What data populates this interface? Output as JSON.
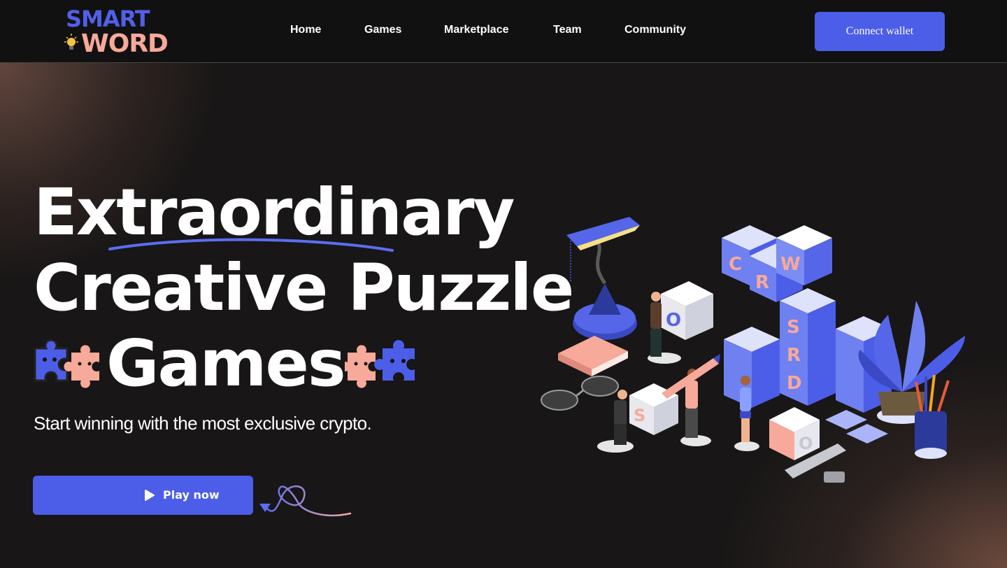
{
  "logo": {
    "line1": "SMART",
    "line2": "WORD"
  },
  "nav": {
    "links": [
      "Home",
      "Games",
      "Marketplace",
      "Team",
      "Community"
    ],
    "connect_label": "Connect wallet"
  },
  "hero": {
    "headline_line1": "Extraordinary",
    "headline_line2": "Creative Puzzle",
    "headline_line3": "Games",
    "subtitle": "Start winning with the most exclusive crypto.",
    "play_label": "Play now"
  },
  "blocks": {
    "letters": [
      "C",
      "R",
      "W",
      "O",
      "S",
      "R",
      "D",
      "S",
      "O"
    ]
  },
  "colors": {
    "accent": "#4c5ee8",
    "peach": "#f7a99a",
    "nav_bg": "#121111",
    "hero_bg": "#181616"
  },
  "icons": [
    "lightbulb-icon",
    "play-icon",
    "puzzle-piece-icon",
    "curly-arrow-icon"
  ]
}
